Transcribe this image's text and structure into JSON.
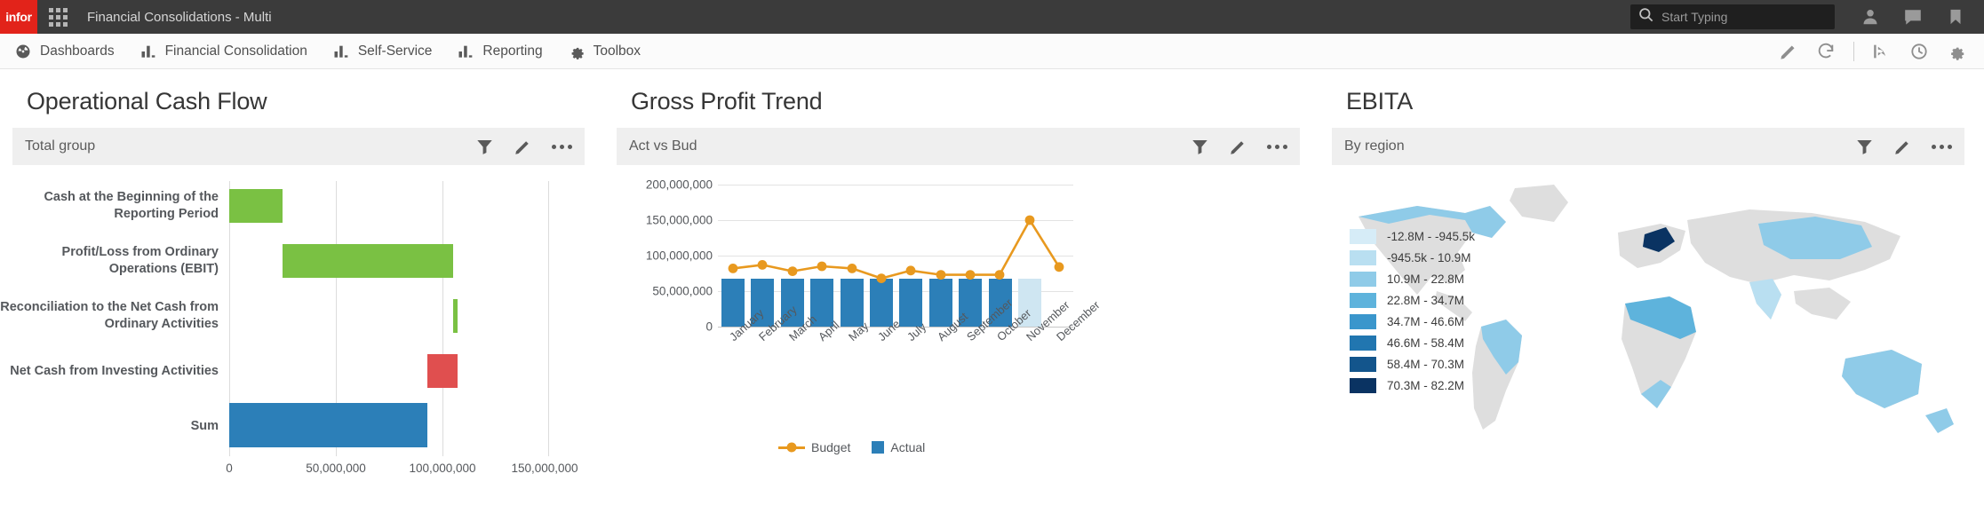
{
  "topbar": {
    "logo": "infor",
    "logo_color": "#e2231a",
    "grid_icon": "app-grid-icon",
    "app_title": "Financial Consolidations - Multi",
    "search": {
      "placeholder": "Start Typing",
      "value": "",
      "icon": "search-icon"
    },
    "icons": [
      {
        "name": "user-icon",
        "label": "User"
      },
      {
        "name": "chat-icon",
        "label": "Messages"
      },
      {
        "name": "bookmark-icon",
        "label": "Bookmarks"
      }
    ]
  },
  "nav": {
    "items": [
      {
        "label": "Dashboards",
        "icon": "dashboard-icon"
      },
      {
        "label": "Financial Consolidation",
        "icon": "bar-chart-icon"
      },
      {
        "label": "Self-Service",
        "icon": "bar-chart-icon"
      },
      {
        "label": "Reporting",
        "icon": "bar-chart-icon"
      },
      {
        "label": "Toolbox",
        "icon": "gear-icon"
      }
    ],
    "right_icons": [
      {
        "name": "pencil-icon",
        "label": "Edit"
      },
      {
        "name": "refresh-icon",
        "label": "Refresh"
      },
      {
        "name": "share-icon",
        "label": "Share"
      },
      {
        "name": "history-icon",
        "label": "History"
      },
      {
        "name": "settings-gear-icon",
        "label": "Settings"
      }
    ]
  },
  "widgets": [
    {
      "title": "Operational Cash Flow",
      "toolbar_label": "Total group",
      "toolbar_icons": [
        {
          "name": "filter-icon"
        },
        {
          "name": "pencil-icon"
        },
        {
          "name": "more-options-icon"
        }
      ]
    },
    {
      "title": "Gross Profit Trend",
      "toolbar_label": "Act vs Bud",
      "toolbar_icons": [
        {
          "name": "filter-icon"
        },
        {
          "name": "pencil-icon"
        },
        {
          "name": "more-options-icon"
        }
      ]
    },
    {
      "title": "EBITA",
      "toolbar_label": "By region",
      "toolbar_icons": [
        {
          "name": "filter-icon"
        },
        {
          "name": "pencil-icon"
        },
        {
          "name": "more-options-icon"
        }
      ]
    }
  ],
  "chart_data": [
    {
      "type": "bar",
      "chart_name": "operational-cash-flow-waterfall",
      "title": "Operational Cash Flow",
      "orientation": "horizontal",
      "categories": [
        "Cash at the Beginning of the Reporting Period",
        "Profit/Loss from Ordinary Operations (EBIT)",
        "Reconciliation to the Net Cash from Ordinary Activities",
        "Net Cash from Investing Activities",
        "Sum"
      ],
      "waterfall": [
        {
          "label": "Cash at the Beginning of the Reporting Period",
          "start": 0,
          "end": 25000000,
          "value": 25000000,
          "color": "#7ac143",
          "direction": "increase"
        },
        {
          "label": "Profit/Loss from Ordinary Operations (EBIT)",
          "start": 25000000,
          "end": 105000000,
          "value": 80000000,
          "color": "#7ac143",
          "direction": "increase"
        },
        {
          "label": "Reconciliation to the Net Cash from Ordinary Activities",
          "start": 105000000,
          "end": 107000000,
          "value": 2000000,
          "color": "#7ac143",
          "direction": "increase"
        },
        {
          "label": "Net Cash from Investing Activities",
          "start": 107000000,
          "end": 93000000,
          "value": -14000000,
          "color": "#e04f4f",
          "direction": "decrease"
        },
        {
          "label": "Sum",
          "start": 0,
          "end": 93000000,
          "value": 93000000,
          "color": "#2c7fb8",
          "direction": "total"
        }
      ],
      "xticks": [
        "0",
        "50,000,000",
        "100,000,000",
        "150,000,000"
      ],
      "xtick_values": [
        0,
        50000000,
        100000000,
        150000000
      ],
      "xlim": [
        0,
        150000000
      ],
      "xlabel": "",
      "ylabel": "",
      "grid": true,
      "colors": {
        "increase": "#7ac143",
        "decrease": "#e04f4f",
        "total": "#2c7fb8"
      }
    },
    {
      "type": "bar",
      "chart_name": "gross-profit-trend-combo",
      "title": "Gross Profit Trend",
      "subtitle": "Act vs Bud",
      "categories": [
        "January",
        "February",
        "March",
        "April",
        "May",
        "June",
        "July",
        "August",
        "September",
        "October",
        "November",
        "December"
      ],
      "series": [
        {
          "name": "Actual",
          "type": "bar",
          "color": "#2c7fb8",
          "values": [
            68000000,
            68000000,
            68000000,
            68000000,
            68000000,
            68000000,
            68000000,
            68000000,
            68000000,
            68000000,
            68000000,
            null
          ],
          "highlight_index": 10,
          "highlight_color": "#cfe6f2"
        },
        {
          "name": "Budget",
          "type": "line",
          "color": "#e8991f",
          "values": [
            82000000,
            87000000,
            78000000,
            85000000,
            81000000,
            68000000,
            79000000,
            73000000,
            73000000,
            73000000,
            150000000,
            84000000
          ]
        }
      ],
      "yticks": [
        "0",
        "50,000,000",
        "100,000,000",
        "150,000,000",
        "200,000,000"
      ],
      "ytick_values": [
        0,
        50000000,
        100000000,
        150000000,
        200000000
      ],
      "ylim": [
        0,
        200000000
      ],
      "xlabel": "",
      "ylabel": "",
      "grid": true,
      "legend": {
        "position": "bottom",
        "entries": [
          "Budget",
          "Actual"
        ]
      }
    },
    {
      "type": "heatmap",
      "chart_name": "ebita-choropleth-map",
      "title": "EBITA",
      "subtitle": "By region",
      "map": "world",
      "legend_title": "",
      "legend": [
        {
          "range": "-12.8M - -945.5k",
          "color": "#d6ecf7"
        },
        {
          "range": "-945.5k - 10.9M",
          "color": "#b9dff1"
        },
        {
          "range": "10.9M - 22.8M",
          "color": "#8fcbe8"
        },
        {
          "range": "22.8M - 34.7M",
          "color": "#5eb3dc"
        },
        {
          "range": "34.7M - 46.6M",
          "color": "#3a96cc"
        },
        {
          "range": "46.6M - 58.4M",
          "color": "#2176b0"
        },
        {
          "range": "58.4M - 70.3M",
          "color": "#13558c"
        },
        {
          "range": "70.3M - 82.2M",
          "color": "#0a3362"
        }
      ],
      "base_color": "#dedede"
    }
  ]
}
